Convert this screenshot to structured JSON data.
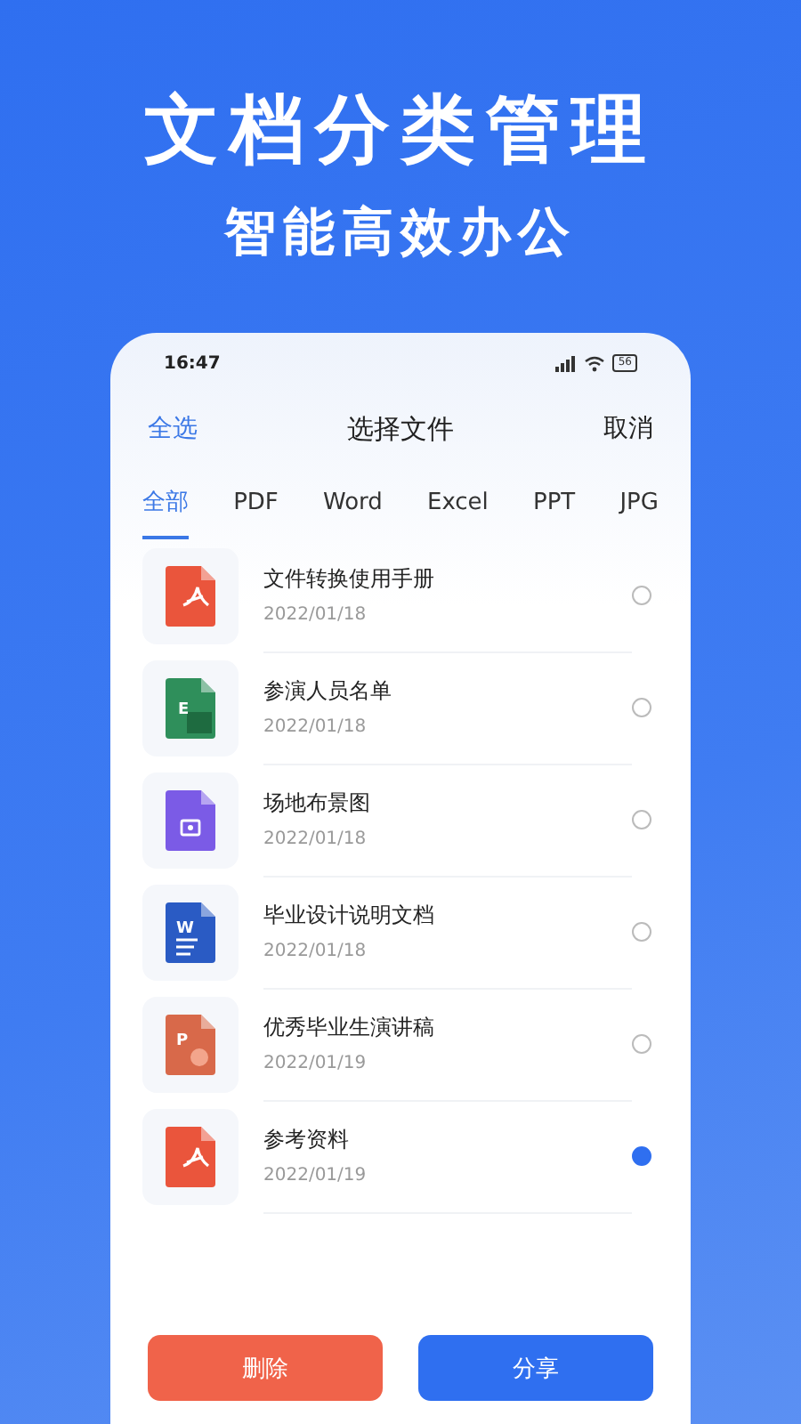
{
  "headline": "文档分类管理",
  "subheadline": "智能高效办公",
  "status_bar": {
    "time": "16:47",
    "battery": "56"
  },
  "header": {
    "left": "全选",
    "title": "选择文件",
    "right": "取消"
  },
  "tabs": [
    {
      "label": "全部",
      "selected": true
    },
    {
      "label": "PDF",
      "selected": false
    },
    {
      "label": "Word",
      "selected": false
    },
    {
      "label": "Excel",
      "selected": false
    },
    {
      "label": "PPT",
      "selected": false
    },
    {
      "label": "JPG",
      "selected": false
    }
  ],
  "files": [
    {
      "kind": "pdf",
      "name": "文件转换使用手册",
      "date": "2022/01/18",
      "selected": false
    },
    {
      "kind": "excel",
      "icon_letter": "E",
      "name": "参演人员名单",
      "date": "2022/01/18",
      "selected": false
    },
    {
      "kind": "image",
      "name": "场地布景图",
      "date": "2022/01/18",
      "selected": false
    },
    {
      "kind": "word",
      "icon_letter": "W",
      "name": "毕业设计说明文档",
      "date": "2022/01/18",
      "selected": false
    },
    {
      "kind": "ppt",
      "icon_letter": "P",
      "name": "优秀毕业生演讲稿",
      "date": "2022/01/19",
      "selected": false
    },
    {
      "kind": "pdf",
      "name": "参考资料",
      "date": "2022/01/19",
      "selected": true
    }
  ],
  "buttons": {
    "delete": "删除",
    "share": "分享"
  }
}
